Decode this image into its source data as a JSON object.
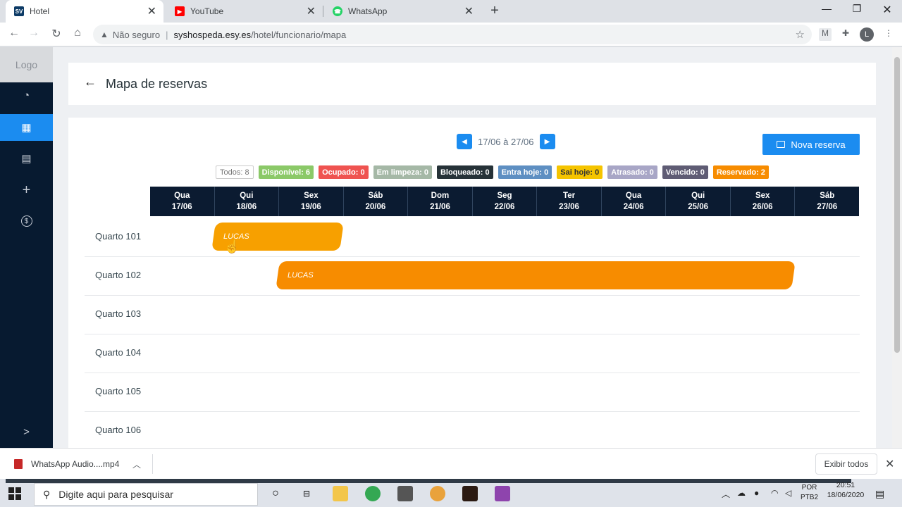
{
  "browser": {
    "tabs": [
      {
        "label": "Hotel",
        "favicon": "SV",
        "color": "#0d3b66"
      },
      {
        "label": "YouTube",
        "favicon": "▶",
        "color": "#ff0000"
      },
      {
        "label": "WhatsApp",
        "favicon": "☎",
        "color": "#25d366"
      }
    ],
    "security_label": "Não seguro",
    "url_host": "syshospeda.esy.es",
    "url_path": "/hotel/funcionario/mapa",
    "profile_initial": "L",
    "ext_label": "M"
  },
  "sidebar": {
    "logo": "Logo",
    "items": [
      {
        "icon": "pie-chart-icon",
        "glyph": "◔"
      },
      {
        "icon": "grid-icon",
        "glyph": "▦"
      },
      {
        "icon": "calendar-icon",
        "glyph": "▤"
      },
      {
        "icon": "plus-icon",
        "glyph": "+"
      },
      {
        "icon": "dollar-icon",
        "glyph": "$"
      }
    ],
    "expand_glyph": ">"
  },
  "header": {
    "title": "Mapa de reservas"
  },
  "date_nav": {
    "range": "17/06 à 27/06"
  },
  "nova_reserva": "Nova reserva",
  "legend": [
    {
      "label": "Todos: 8",
      "color": "#ffffff"
    },
    {
      "label": "Disponível: 6",
      "color": "#8bc968"
    },
    {
      "label": "Ocupado: 0",
      "color": "#ef5350"
    },
    {
      "label": "Em limpeza: 0",
      "color": "#a5b8a6"
    },
    {
      "label": "Bloqueado: 0",
      "color": "#263238"
    },
    {
      "label": "Entra hoje: 0",
      "color": "#5e8fc2"
    },
    {
      "label": "Sai hoje: 0",
      "color": "#f5c400"
    },
    {
      "label": "Atrasado: 0",
      "color": "#a8a6c6"
    },
    {
      "label": "Vencido: 0",
      "color": "#5f5c74"
    },
    {
      "label": "Reservado: 2",
      "color": "#f78c00"
    }
  ],
  "days": [
    {
      "dow": "Qua",
      "date": "17/06"
    },
    {
      "dow": "Qui",
      "date": "18/06"
    },
    {
      "dow": "Sex",
      "date": "19/06"
    },
    {
      "dow": "Sáb",
      "date": "20/06"
    },
    {
      "dow": "Dom",
      "date": "21/06"
    },
    {
      "dow": "Seg",
      "date": "22/06"
    },
    {
      "dow": "Ter",
      "date": "23/06"
    },
    {
      "dow": "Qua",
      "date": "24/06"
    },
    {
      "dow": "Qui",
      "date": "25/06"
    },
    {
      "dow": "Sex",
      "date": "26/06"
    },
    {
      "dow": "Sáb",
      "date": "27/06"
    }
  ],
  "rooms": [
    "Quarto 101",
    "Quarto 102",
    "Quarto 103",
    "Quarto 104",
    "Quarto 105",
    "Quarto 106"
  ],
  "bookings": [
    {
      "guest": "LUCAS",
      "room": "Quarto 101",
      "from": "18/06",
      "to": "19/06"
    },
    {
      "guest": "LUCAS",
      "room": "Quarto 102",
      "from": "19/06",
      "to": "26/06"
    }
  ],
  "download": {
    "file": "WhatsApp Audio....mp4",
    "show_all": "Exibir todos"
  },
  "taskbar": {
    "search_placeholder": "Digite aqui para pesquisar",
    "lang": "POR",
    "kbd": "PTB2",
    "time": "20:51",
    "date": "18/06/2020"
  }
}
